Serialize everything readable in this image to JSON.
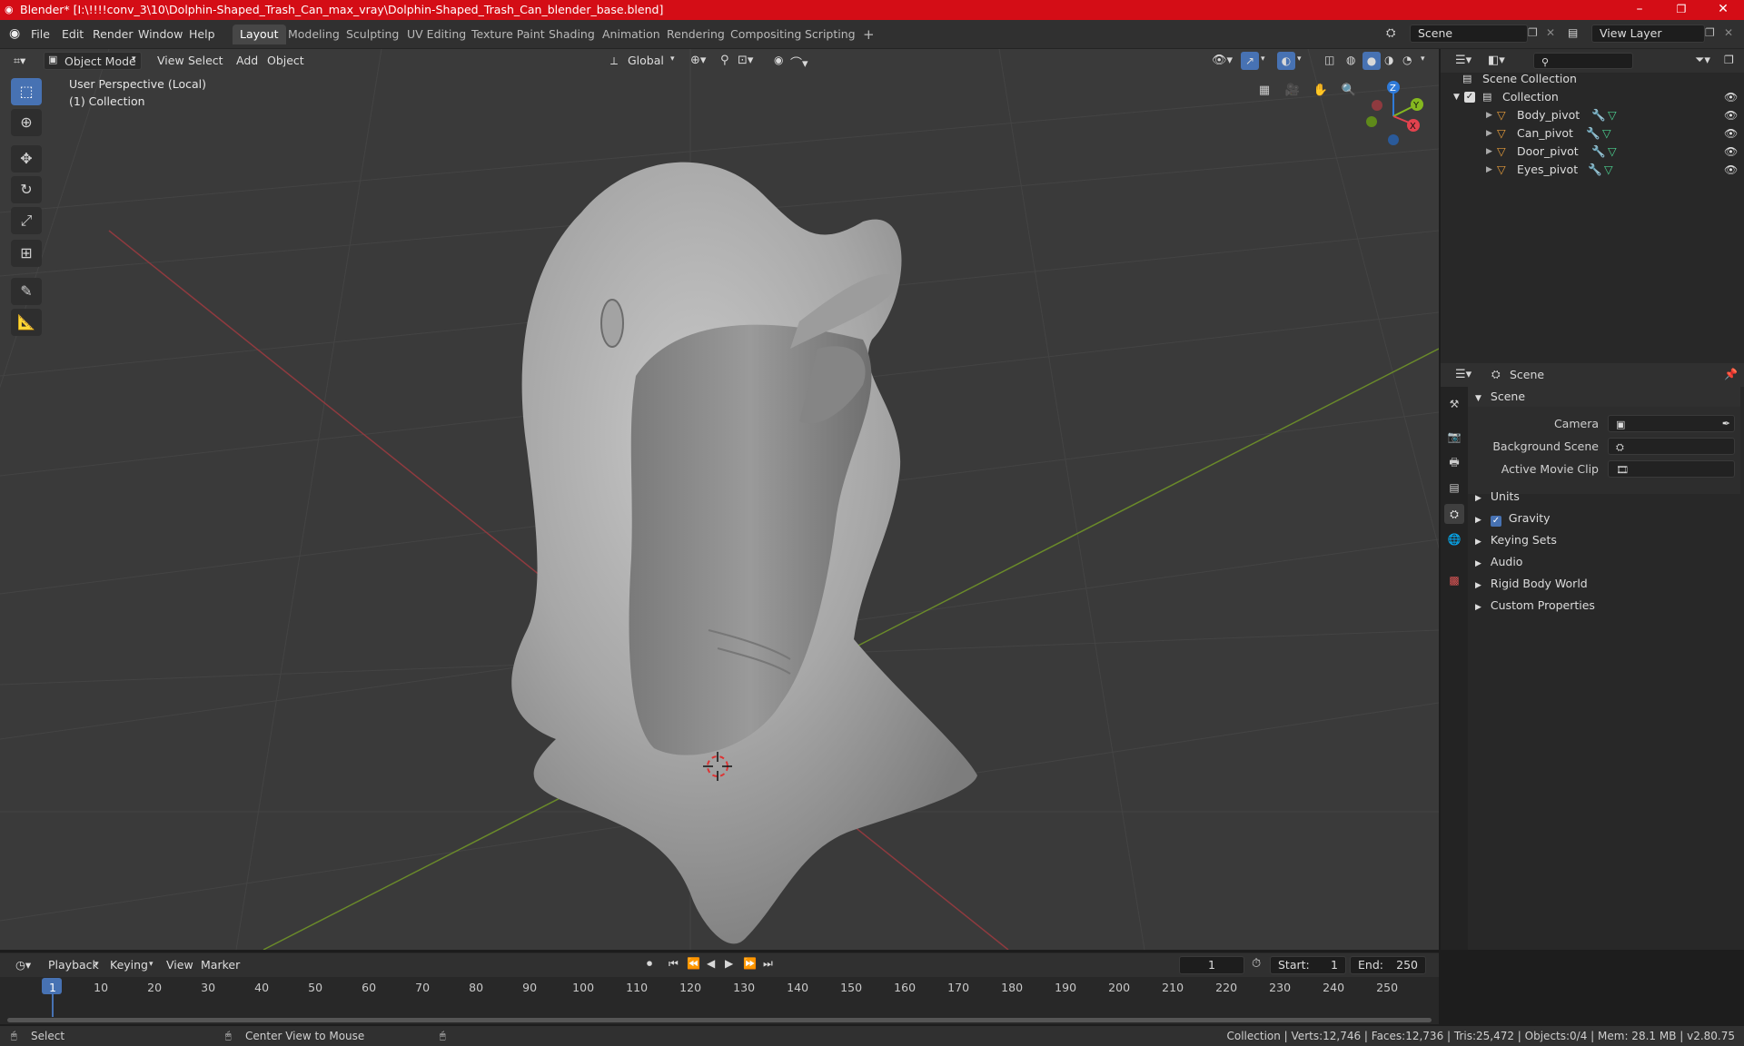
{
  "window": {
    "title": "Blender* [I:\\!!!!conv_3\\10\\Dolphin-Shaped_Trash_Can_max_vray\\Dolphin-Shaped_Trash_Can_blender_base.blend]",
    "minimize": "–",
    "maximize": "❐",
    "close": "✕"
  },
  "menubar": {
    "items": [
      "File",
      "Edit",
      "Render",
      "Window",
      "Help"
    ]
  },
  "workspaces": {
    "tabs": [
      "Layout",
      "Modeling",
      "Sculpting",
      "UV Editing",
      "Texture Paint",
      "Shading",
      "Animation",
      "Rendering",
      "Compositing",
      "Scripting"
    ],
    "active": "Layout",
    "add": "+"
  },
  "scene_selector": {
    "value": "Scene"
  },
  "view_layer_selector": {
    "value": "View Layer"
  },
  "viewport_header": {
    "mode": "Object Mode",
    "menus": [
      "View",
      "Select",
      "Add",
      "Object"
    ],
    "orientation": "Global"
  },
  "viewport": {
    "perspective": "User Perspective (Local)",
    "collection": "(1) Collection",
    "axis_x": "X",
    "axis_y": "Y",
    "axis_z": "Z"
  },
  "outliner": {
    "root": "Scene Collection",
    "collection": "Collection",
    "objects": [
      "Body_pivot",
      "Can_pivot",
      "Door_pivot",
      "Eyes_pivot"
    ]
  },
  "properties": {
    "context": "Scene",
    "section": "Scene",
    "camera_label": "Camera",
    "background_scene_label": "Background Scene",
    "active_movie_clip_label": "Active Movie Clip",
    "panels": [
      "Units",
      "Gravity",
      "Keying Sets",
      "Audio",
      "Rigid Body World",
      "Custom Properties"
    ],
    "gravity_checked": true
  },
  "timeline": {
    "menus": [
      "Playback",
      "Keying",
      "View",
      "Marker"
    ],
    "current_frame": "1",
    "start_label": "Start:",
    "start_value": "1",
    "end_label": "End:",
    "end_value": "250",
    "ticks": [
      "1",
      "10",
      "20",
      "30",
      "40",
      "50",
      "60",
      "70",
      "80",
      "90",
      "100",
      "110",
      "120",
      "130",
      "140",
      "150",
      "160",
      "170",
      "180",
      "190",
      "200",
      "210",
      "220",
      "230",
      "240",
      "250"
    ]
  },
  "statusbar": {
    "select": "Select",
    "center_view": "Center View to Mouse",
    "stats": "Collection | Verts:12,746 | Faces:12,736 | Tris:25,472 | Objects:0/4 | Mem: 28.1 MB | v2.80.75"
  },
  "colors": {
    "titlebar": "#d40d16",
    "accent": "#4772b3",
    "viewport_bg": "#3a3a3a",
    "x_axis": "#e2424e",
    "y_axis": "#85b81f",
    "z_axis": "#2f7ad8",
    "object_orange": "#e39a3a",
    "modifier_blue": "#7ab0e8",
    "mesh_green": "#4bd08f"
  }
}
